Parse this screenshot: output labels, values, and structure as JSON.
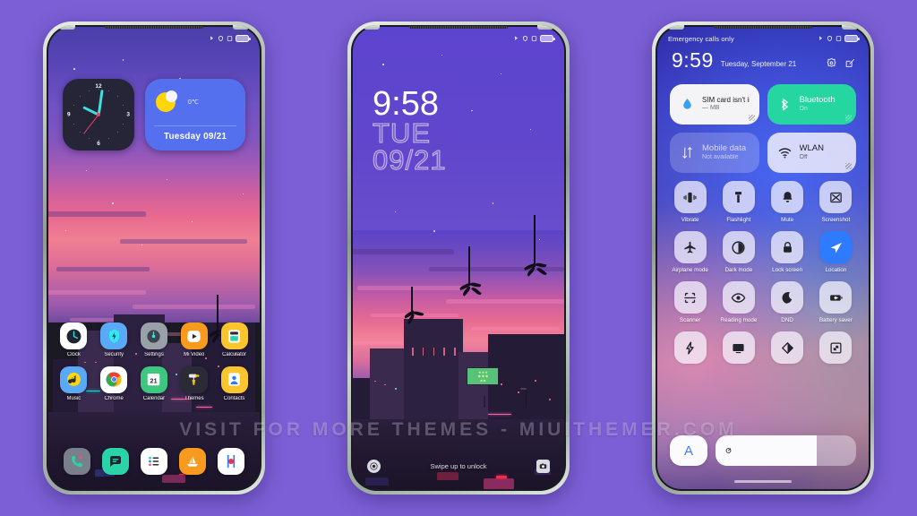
{
  "background_color": "#7b5fd6",
  "watermark": "VISIT FOR MORE THEMES - MIUITHEMER.COM",
  "phone1": {
    "name": "home-screen",
    "statusbar": {
      "left": "",
      "icons": [
        "bluetooth-icon",
        "security-shield-icon",
        "alarm-icon",
        "battery-icon"
      ]
    },
    "clock_widget": {
      "numbers": [
        "12",
        "3",
        "6",
        "9"
      ],
      "hand_colors": {
        "hour": "#3fe0dc",
        "minute": "#3fe0dc",
        "second": "#e8415e"
      },
      "background": "#262437"
    },
    "weather_widget": {
      "temperature": "0℃",
      "date": "Tuesday 09/21",
      "icon": "sun-icon",
      "background": "#5470ef"
    },
    "apps_row1": [
      {
        "label": "Clock",
        "icon": "clock-icon"
      },
      {
        "label": "Security",
        "icon": "shield-bolt-icon"
      },
      {
        "label": "Settings",
        "icon": "settings-gear-icon"
      },
      {
        "label": "Mi Video",
        "icon": "video-play-icon"
      },
      {
        "label": "Calculator",
        "icon": "calculator-icon"
      }
    ],
    "apps_row2": [
      {
        "label": "Music",
        "icon": "music-note-icon"
      },
      {
        "label": "Chrome",
        "icon": "chrome-icon"
      },
      {
        "label": "Calendar",
        "icon": "calendar-21-icon"
      },
      {
        "label": "Themes",
        "icon": "paint-roller-icon"
      },
      {
        "label": "Contacts",
        "icon": "contacts-person-icon"
      }
    ],
    "dock": [
      {
        "label": "Phone",
        "icon": "phone-handset-icon"
      },
      {
        "label": "Messages",
        "icon": "message-bubble-icon"
      },
      {
        "label": "Notes",
        "icon": "notes-list-icon"
      },
      {
        "label": "Browser",
        "icon": "browser-boat-icon"
      },
      {
        "label": "Camera",
        "icon": "camera-lens-icon"
      }
    ]
  },
  "phone2": {
    "name": "lock-screen",
    "statusbar": {
      "left": "",
      "icons": [
        "bluetooth-icon",
        "security-shield-icon",
        "alarm-icon",
        "battery-icon"
      ]
    },
    "time": "9:58",
    "day_of_week": "TUE",
    "date": "09/21",
    "unlock_hint": "Swipe up to unlock",
    "left_shortcut": "flashlight-icon",
    "right_shortcut": "camera-icon"
  },
  "phone3": {
    "name": "control-center",
    "statusbar": {
      "left": "Emergency calls only",
      "icons": [
        "bluetooth-icon",
        "security-shield-icon",
        "alarm-icon",
        "battery-icon"
      ]
    },
    "time": "9:59",
    "date": "Tuesday, September 21",
    "header_icons": [
      "settings-gear-icon",
      "edit-pencil-icon"
    ],
    "big_tiles": [
      {
        "title": "SIM card isn't installed",
        "sub": "— MB",
        "icon": "data-drop-icon",
        "state": "off",
        "style": "light"
      },
      {
        "title": "Bluetooth",
        "sub": "On",
        "icon": "bluetooth-icon",
        "state": "on",
        "style": "green"
      },
      {
        "title": "Mobile data",
        "sub": "Not available",
        "icon": "mobile-data-arrows-icon",
        "state": "disabled",
        "style": "dim"
      },
      {
        "title": "WLAN",
        "sub": "Off",
        "icon": "wifi-icon",
        "state": "off",
        "style": "frost"
      }
    ],
    "tiles": [
      {
        "label": "Vibrate",
        "icon": "vibrate-icon",
        "state": "off"
      },
      {
        "label": "Flashlight",
        "icon": "flashlight-icon",
        "state": "off"
      },
      {
        "label": "Mute",
        "icon": "bell-mute-icon",
        "state": "off"
      },
      {
        "label": "Screenshot",
        "icon": "screenshot-icon",
        "state": "off"
      },
      {
        "label": "Airplane mode",
        "icon": "airplane-icon",
        "state": "off"
      },
      {
        "label": "Dark mode",
        "icon": "dark-mode-contrast-icon",
        "state": "off"
      },
      {
        "label": "Lock screen",
        "icon": "lock-icon",
        "state": "off"
      },
      {
        "label": "Location",
        "icon": "location-arrow-icon",
        "state": "on"
      },
      {
        "label": "Scanner",
        "icon": "scanner-frame-icon",
        "state": "off"
      },
      {
        "label": "Reading mode",
        "icon": "eye-icon",
        "state": "off"
      },
      {
        "label": "DND",
        "icon": "moon-icon",
        "state": "off"
      },
      {
        "label": "Battery saver",
        "icon": "battery-saver-icon",
        "state": "off"
      }
    ],
    "tiles_last_row": [
      {
        "label": "",
        "icon": "lightning-bolt-icon",
        "state": "off"
      },
      {
        "label": "",
        "icon": "cast-screen-icon",
        "state": "off"
      },
      {
        "label": "",
        "icon": "contrast-half-icon",
        "state": "off"
      },
      {
        "label": "",
        "icon": "expand-arrows-icon",
        "state": "off"
      }
    ],
    "brightness": {
      "auto_label": "A",
      "auto_state": "on",
      "level_percent": 72,
      "slider_icon": "brightness-sun-icon"
    }
  }
}
